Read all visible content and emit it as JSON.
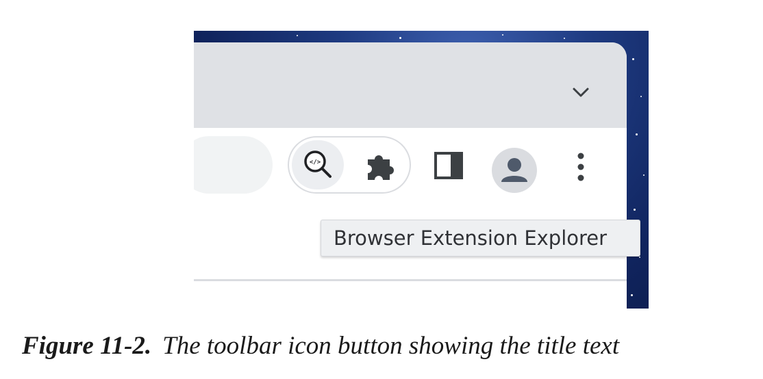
{
  "screenshot": {
    "tabstrip": {
      "chevron_icon": "chevron-down-icon"
    },
    "toolbar": {
      "extension_button": {
        "icon": "code-magnifier-icon",
        "glyph": "</>"
      },
      "extensions_menu": {
        "icon": "puzzle-piece-icon"
      },
      "side_panel": {
        "icon": "side-panel-icon"
      },
      "profile": {
        "icon": "person-icon"
      },
      "menu": {
        "icon": "vertical-dots-icon"
      }
    },
    "tooltip": {
      "text": "Browser Extension Explorer"
    },
    "colors": {
      "tabstrip": "#dfe1e5",
      "toolbar": "#ffffff",
      "icon": "#3c4043",
      "avatar_bg": "#dadce0",
      "avatar_fg": "#4f5a6b",
      "background": "#1e3a80"
    }
  },
  "caption": {
    "label": "Figure 11-2.",
    "text": "The toolbar icon button showing the title text"
  }
}
